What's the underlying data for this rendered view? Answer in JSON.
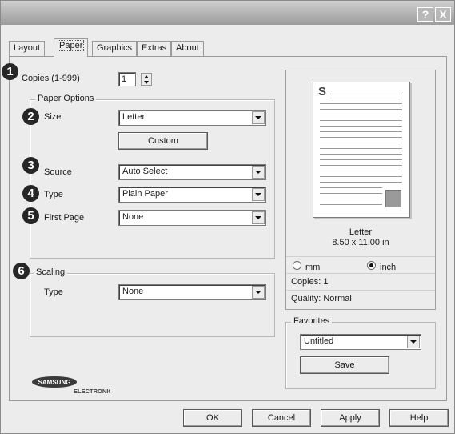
{
  "titlebar": {
    "help_glyph": "?",
    "close_glyph": "X"
  },
  "tabs": [
    {
      "label": "Layout",
      "active": false
    },
    {
      "label": "Paper",
      "active": true
    },
    {
      "label": "Graphics",
      "active": false
    },
    {
      "label": "Extras",
      "active": false
    },
    {
      "label": "About",
      "active": false
    }
  ],
  "callouts": [
    "1",
    "2",
    "3",
    "4",
    "5",
    "6"
  ],
  "copies": {
    "label": "Copies (1-999)",
    "value": "1"
  },
  "paper_options": {
    "legend": "Paper Options",
    "size_label": "Size",
    "size_value": "Letter",
    "custom_label": "Custom",
    "source_label": "Source",
    "source_value": "Auto Select",
    "type_label": "Type",
    "type_value": "Plain Paper",
    "first_page_label": "First Page",
    "first_page_value": "None"
  },
  "scaling": {
    "legend": "Scaling",
    "type_label": "Type",
    "type_value": "None"
  },
  "preview": {
    "page_letter": "S",
    "paper_name": "Letter",
    "paper_dims": "8.50 x 11.00 in",
    "unit_mm": "mm",
    "unit_inch": "inch",
    "selected_unit": "inch",
    "copies_text": "Copies: 1",
    "quality_text": "Quality: Normal"
  },
  "favorites": {
    "legend": "Favorites",
    "value": "Untitled",
    "save_label": "Save"
  },
  "brand": {
    "name": "SAMSUNG",
    "sub": "ELECTRONICS"
  },
  "footer": {
    "ok": "OK",
    "cancel": "Cancel",
    "apply": "Apply",
    "help": "Help"
  }
}
